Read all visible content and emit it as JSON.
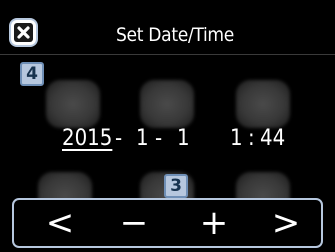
{
  "header": {
    "title": "Set Date/Time",
    "close_icon": "close-icon"
  },
  "callouts": {
    "close": "4",
    "controls": "3"
  },
  "datetime": {
    "year": "2015",
    "month": "1",
    "day": "1",
    "hour": "1",
    "minute": "44",
    "date_separator": "-",
    "time_separator": ":"
  },
  "controls": {
    "prev": "<",
    "decrement": "−",
    "increment": "+",
    "next": ">"
  },
  "colors": {
    "background": "#000000",
    "callout_fill": "#b6c7de",
    "callout_border": "#6f8fb6",
    "text": "#ffffff"
  }
}
